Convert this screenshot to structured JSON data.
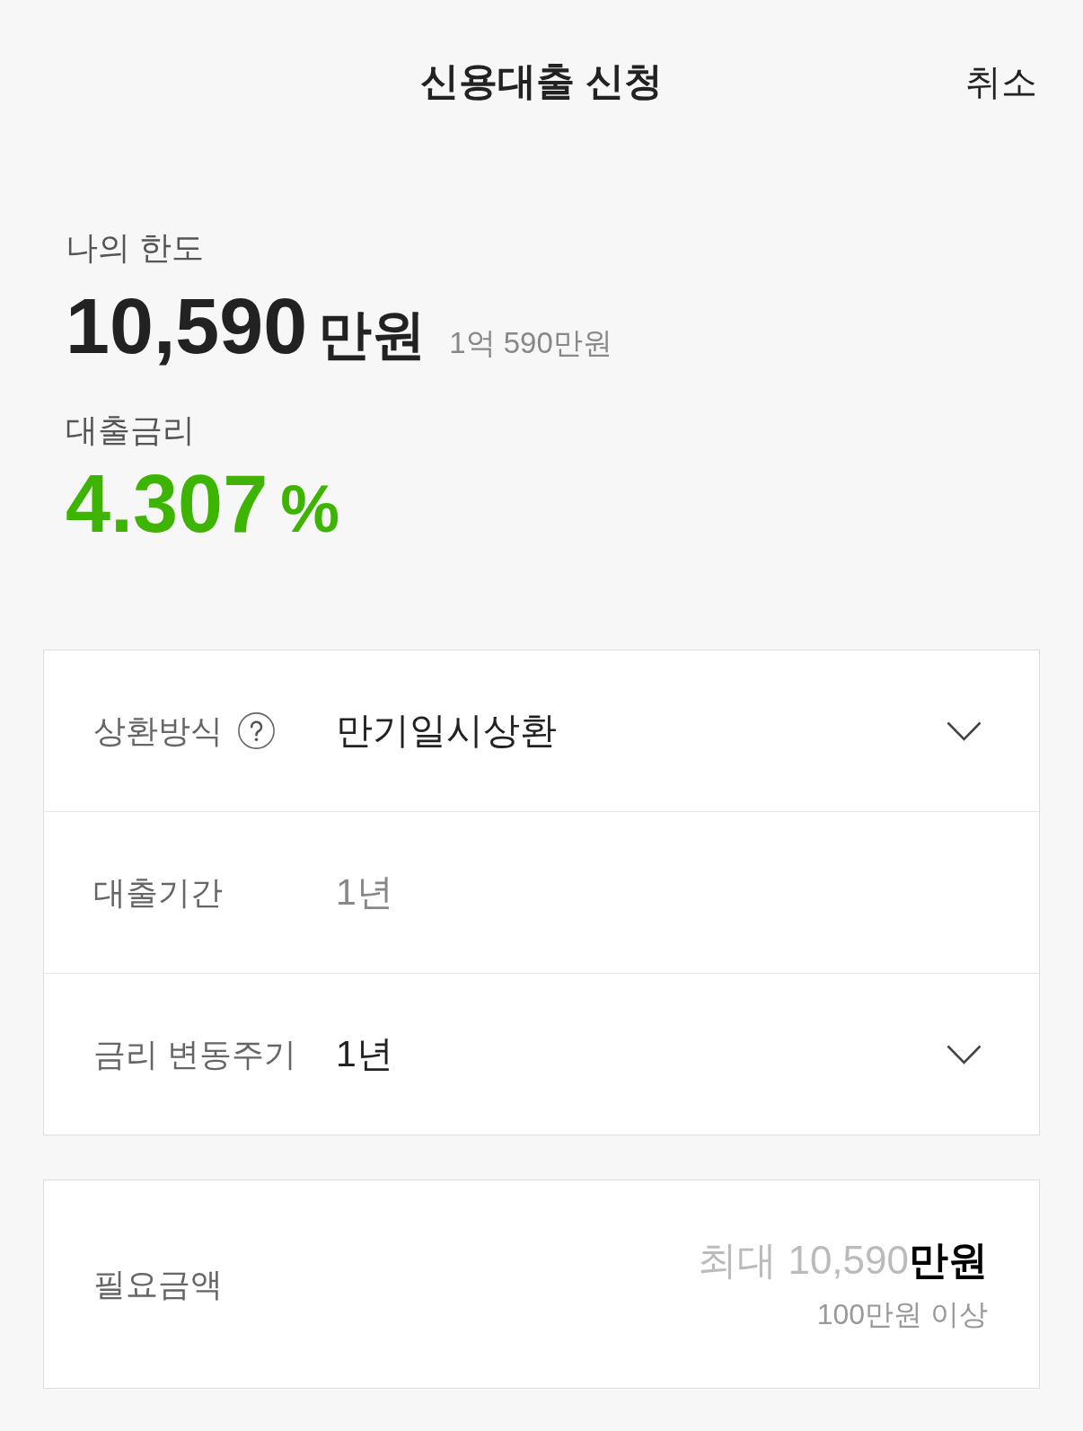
{
  "header": {
    "title": "신용대출 신청",
    "cancel": "취소"
  },
  "limit": {
    "label": "나의 한도",
    "amount": "10,590",
    "unit": "만원",
    "amount_in_words": "1억 590만원"
  },
  "rate": {
    "label": "대출금리",
    "value": "4.307",
    "unit": "%"
  },
  "options": [
    {
      "label": "상환방식",
      "help_icon": true,
      "value": "만기일시상환",
      "disabled": false
    },
    {
      "label": "대출기간",
      "help_icon": false,
      "value": "1년",
      "disabled": true
    },
    {
      "label": "금리 변동주기",
      "help_icon": false,
      "value": "1년",
      "disabled": false
    }
  ],
  "amount_field": {
    "label": "필요금액",
    "placeholder": "최대 10,590",
    "unit": "만원",
    "hint": "100만원 이상"
  }
}
